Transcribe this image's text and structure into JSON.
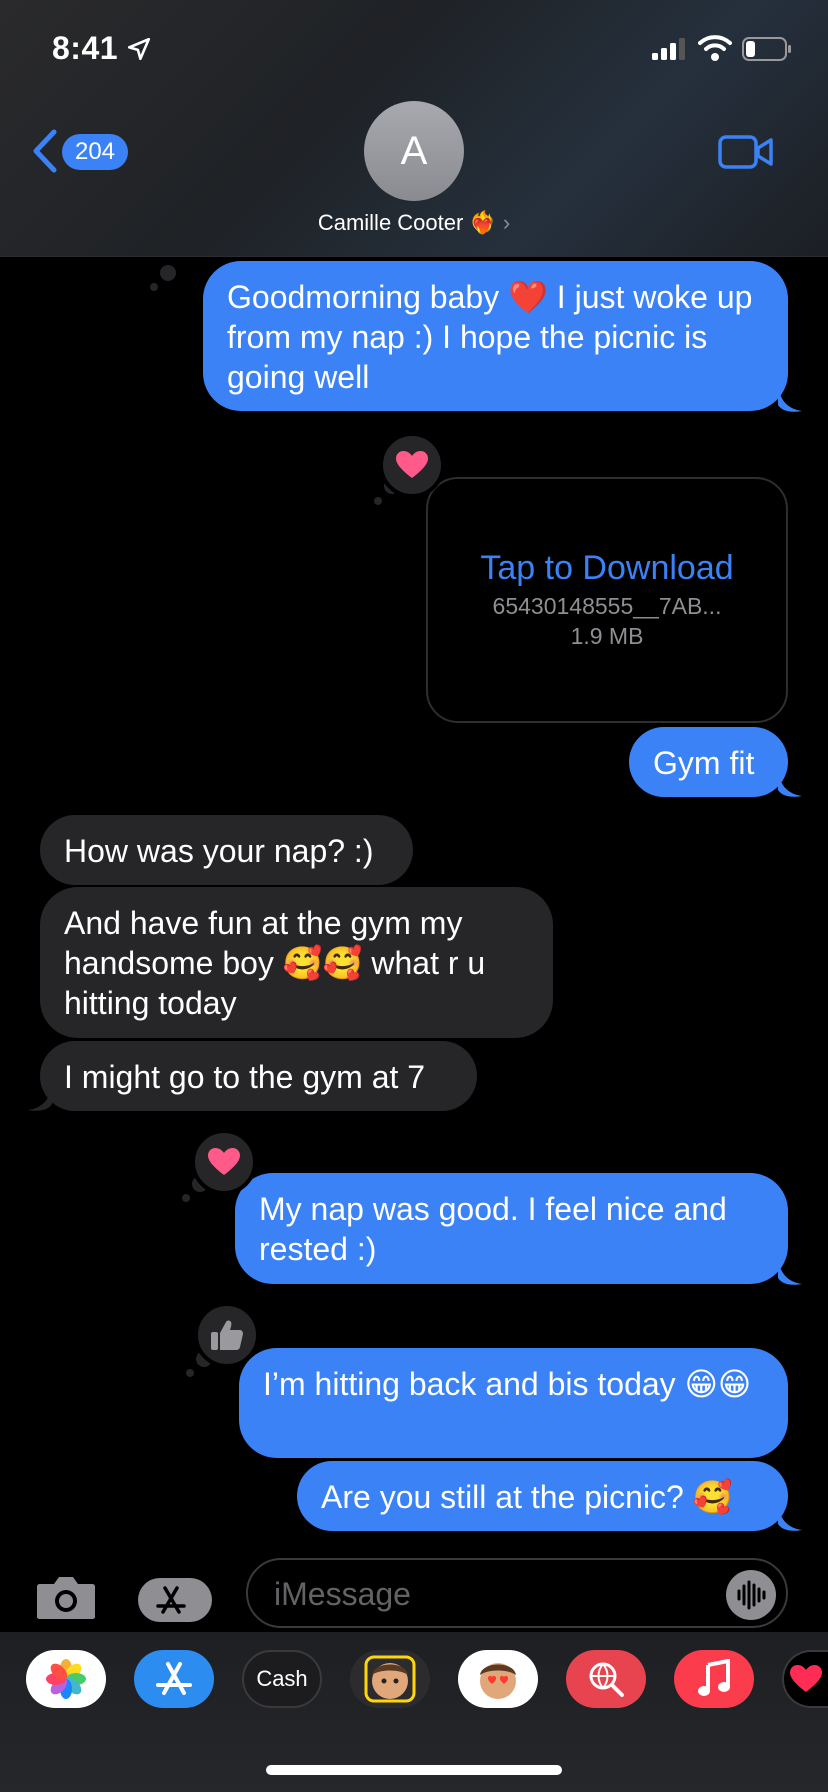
{
  "status_bar": {
    "time": "8:41"
  },
  "nav": {
    "back_count": "204",
    "avatar_initial": "A",
    "contact_name": "Camille Cooter ❤️‍🔥",
    "chevron": "›"
  },
  "messages": [
    {
      "dir": "out",
      "text": "Goodmorning baby ❤️ I just woke up from my nap :) I hope the picnic is going well",
      "reaction": "heart"
    },
    {
      "dir": "out",
      "type": "attachment",
      "action": "Tap to Download",
      "filename": "65430148555__7AB...",
      "size": "1.9 MB",
      "reaction": "heart"
    },
    {
      "dir": "out",
      "text": "Gym fit"
    },
    {
      "dir": "in",
      "text": "How was your nap? :)"
    },
    {
      "dir": "in",
      "text": "And have fun at the gym my handsome boy 🥰🥰 what r u hitting today"
    },
    {
      "dir": "in",
      "text": "I might go to the gym at 7"
    },
    {
      "dir": "out",
      "text": "My nap was good. I feel nice and rested :)",
      "reaction": "heart"
    },
    {
      "dir": "out",
      "text": "I’m hitting back and bis today 😁😁",
      "reaction": "thumbs-up"
    },
    {
      "dir": "out",
      "text": "Are you still at the picnic? 🥰"
    }
  ],
  "composer": {
    "placeholder": "iMessage"
  },
  "app_drawer": [
    {
      "name": "photos-app-icon"
    },
    {
      "name": "app-store-icon"
    },
    {
      "name": "apple-cash-icon",
      "label": "Cash"
    },
    {
      "name": "memoji-icon"
    },
    {
      "name": "memoji-stickers-icon"
    },
    {
      "name": "web-images-search-icon"
    },
    {
      "name": "music-icon"
    },
    {
      "name": "digital-touch-icon"
    }
  ],
  "colors": {
    "accent": "#3b82f6",
    "incoming_bubble": "#262629",
    "heart": "#ff5a8a"
  },
  "icons": [
    "location-arrow-icon",
    "signal-icon",
    "wifi-icon",
    "battery-icon",
    "back-chevron-icon",
    "video-call-icon",
    "camera-icon",
    "apps-icon",
    "audio-waveform-icon"
  ]
}
